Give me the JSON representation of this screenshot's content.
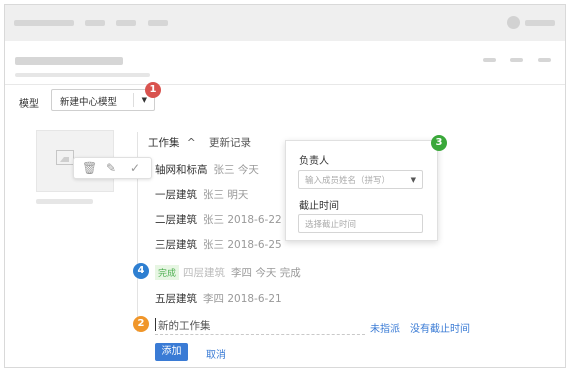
{
  "model": {
    "label": "模型",
    "selected": "新建中心模型",
    "caret_icon": "chevron-down-icon"
  },
  "badges": {
    "b1": "1",
    "b2": "2",
    "b3": "3",
    "b4": "4"
  },
  "workset": {
    "title": "工作集",
    "collapse_icon": "chevron-up-icon",
    "update_link": "更新记录"
  },
  "toolbar_icons": [
    "trash-icon",
    "edit-icon",
    "check-icon"
  ],
  "items": [
    {
      "name": "轴网和标高",
      "meta": "张三 今天"
    },
    {
      "name": "一层建筑",
      "meta": "张三 明天"
    },
    {
      "name": "二层建筑",
      "meta": "张三 2018-6-22"
    },
    {
      "name": "三层建筑",
      "meta": "张三 2018-6-25"
    },
    {
      "tag": "完成",
      "name": "四层建筑",
      "meta": "李四 今天 完成"
    },
    {
      "name": "五层建筑",
      "meta": "李四 2018-6-21"
    }
  ],
  "popover": {
    "owner_label": "负责人",
    "owner_placeholder": "输入成员姓名（拼写）",
    "deadline_label": "截止时间",
    "deadline_placeholder": "选择截止时间"
  },
  "new_item": {
    "placeholder": "新的工作集",
    "assign_link": "未指派",
    "deadline_link": "没有截止时间"
  },
  "actions": {
    "add": "添加",
    "cancel": "取消"
  },
  "colors": {
    "accent": "#3a7bd5",
    "badge_red": "#d9534f",
    "badge_green": "#3aa83a",
    "badge_blue": "#2e7fd1",
    "badge_orange": "#f0962a"
  }
}
